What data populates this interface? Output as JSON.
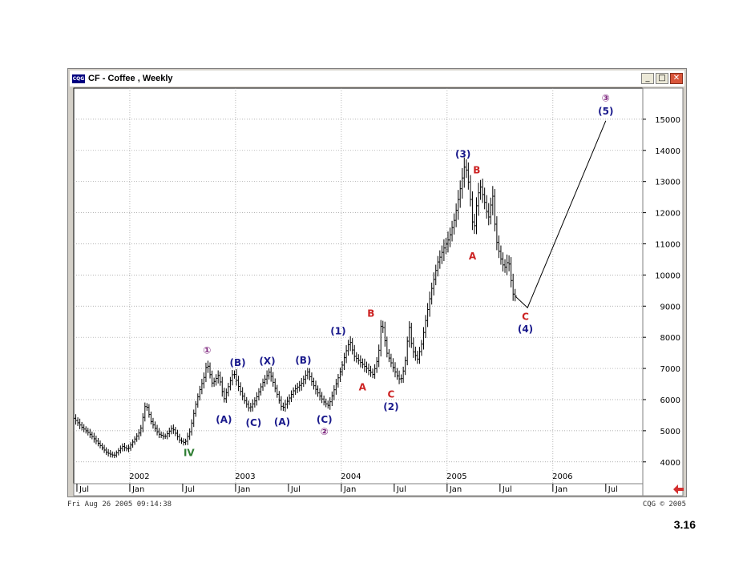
{
  "window": {
    "title": "CF - Coffee , Weekly",
    "icon": "cqg-app-icon",
    "app_icon_text": "CQG",
    "buttons": {
      "minimize": "_",
      "maximize": "□",
      "close": "✕"
    }
  },
  "footer": {
    "timestamp": "Fri Aug 26 2005 09:14:38",
    "copyright": "CQG © 2005"
  },
  "slide_number": "3.16",
  "scroll_arrow_icon": "left-arrow-icon",
  "colors": {
    "price_bars": "#000000",
    "label_blue": "#1a1a8c",
    "label_red": "#cc2222",
    "label_purple": "#7a1f7a",
    "label_green": "#2e7d32",
    "grid": "#9a9a9a",
    "arrow": "#d32f2f"
  },
  "chart_data": {
    "type": "bar",
    "title": "",
    "xlabel": "",
    "ylabel": "",
    "ylim": [
      3300,
      16000
    ],
    "y_ticks": [
      4000,
      5000,
      6000,
      7000,
      8000,
      9000,
      10000,
      11000,
      12000,
      13000,
      14000,
      15000
    ],
    "y_tick_labels": [
      "4000",
      "5000",
      "6000",
      "7000",
      "8000",
      "9000",
      "10000",
      "11000",
      "12000",
      "13000",
      "14000",
      "15000"
    ],
    "x_range": [
      2001.47,
      2006.85
    ],
    "x_year_labels": [
      {
        "label": "2002",
        "x": 2002.0
      },
      {
        "label": "2003",
        "x": 2003.0
      },
      {
        "label": "2004",
        "x": 2004.0
      },
      {
        "label": "2005",
        "x": 2005.0
      },
      {
        "label": "2006",
        "x": 2006.0
      }
    ],
    "x_month_labels": [
      {
        "label": "Jul",
        "x": 2001.5
      },
      {
        "label": "Jan",
        "x": 2002.0
      },
      {
        "label": "Jul",
        "x": 2002.5
      },
      {
        "label": "Jan",
        "x": 2003.0
      },
      {
        "label": "Jul",
        "x": 2003.5
      },
      {
        "label": "Jan",
        "x": 2004.0
      },
      {
        "label": "Jul",
        "x": 2004.5
      },
      {
        "label": "Jan",
        "x": 2005.0
      },
      {
        "label": "Jul",
        "x": 2005.5
      },
      {
        "label": "Jan",
        "x": 2006.0
      },
      {
        "label": "Jul",
        "x": 2006.5
      }
    ],
    "grid": true,
    "price_path": [
      [
        2001.47,
        5400
      ],
      [
        2001.55,
        5100
      ],
      [
        2001.62,
        4900
      ],
      [
        2001.7,
        4600
      ],
      [
        2001.78,
        4300
      ],
      [
        2001.85,
        4200
      ],
      [
        2001.93,
        4500
      ],
      [
        2001.98,
        4400
      ],
      [
        2002.04,
        4700
      ],
      [
        2002.1,
        5000
      ],
      [
        2002.15,
        5900
      ],
      [
        2002.2,
        5300
      ],
      [
        2002.27,
        4900
      ],
      [
        2002.33,
        4800
      ],
      [
        2002.4,
        5100
      ],
      [
        2002.47,
        4700
      ],
      [
        2002.52,
        4600
      ],
      [
        2002.57,
        5000
      ],
      [
        2002.62,
        5800
      ],
      [
        2002.66,
        6300
      ],
      [
        2002.7,
        6700
      ],
      [
        2002.73,
        7200
      ],
      [
        2002.78,
        6500
      ],
      [
        2002.84,
        6800
      ],
      [
        2002.89,
        6000
      ],
      [
        2002.93,
        6400
      ],
      [
        2002.98,
        6900
      ],
      [
        2003.03,
        6400
      ],
      [
        2003.08,
        6000
      ],
      [
        2003.13,
        5700
      ],
      [
        2003.19,
        6000
      ],
      [
        2003.25,
        6500
      ],
      [
        2003.32,
        6900
      ],
      [
        2003.38,
        6300
      ],
      [
        2003.44,
        5700
      ],
      [
        2003.5,
        6000
      ],
      [
        2003.55,
        6300
      ],
      [
        2003.62,
        6500
      ],
      [
        2003.68,
        6900
      ],
      [
        2003.73,
        6500
      ],
      [
        2003.78,
        6200
      ],
      [
        2003.84,
        5900
      ],
      [
        2003.88,
        5800
      ],
      [
        2003.94,
        6400
      ],
      [
        2004.0,
        7000
      ],
      [
        2004.04,
        7500
      ],
      [
        2004.08,
        7900
      ],
      [
        2004.12,
        7400
      ],
      [
        2004.18,
        7200
      ],
      [
        2004.24,
        7000
      ],
      [
        2004.3,
        6800
      ],
      [
        2004.35,
        7400
      ],
      [
        2004.38,
        8600
      ],
      [
        2004.43,
        7500
      ],
      [
        2004.48,
        7100
      ],
      [
        2004.52,
        6800
      ],
      [
        2004.56,
        6600
      ],
      [
        2004.6,
        7100
      ],
      [
        2004.64,
        8400
      ],
      [
        2004.67,
        7600
      ],
      [
        2004.72,
        7300
      ],
      [
        2004.76,
        7800
      ],
      [
        2004.8,
        8600
      ],
      [
        2004.85,
        9500
      ],
      [
        2004.91,
        10400
      ],
      [
        2004.96,
        10800
      ],
      [
        2005.02,
        11200
      ],
      [
        2005.07,
        11800
      ],
      [
        2005.12,
        12700
      ],
      [
        2005.17,
        13600
      ],
      [
        2005.21,
        12800
      ],
      [
        2005.25,
        11300
      ],
      [
        2005.28,
        12300
      ],
      [
        2005.31,
        12900
      ],
      [
        2005.35,
        12400
      ],
      [
        2005.39,
        11800
      ],
      [
        2005.43,
        12600
      ],
      [
        2005.46,
        11200
      ],
      [
        2005.5,
        10600
      ],
      [
        2005.54,
        10200
      ],
      [
        2005.58,
        10500
      ],
      [
        2005.62,
        9400
      ],
      [
        2005.65,
        9300
      ]
    ],
    "projection": [
      [
        2005.65,
        9300
      ],
      [
        2005.76,
        8950
      ],
      [
        2006.5,
        14950
      ]
    ],
    "wave_labels": [
      {
        "text": "IV",
        "x": 2002.56,
        "y": 4280,
        "color": "green"
      },
      {
        "text": "①",
        "x": 2002.73,
        "y": 7570,
        "color": "purple"
      },
      {
        "text": "(A)",
        "x": 2002.89,
        "y": 5340,
        "color": "blue"
      },
      {
        "text": "(B)",
        "x": 2003.02,
        "y": 7170,
        "color": "blue"
      },
      {
        "text": "(C)",
        "x": 2003.17,
        "y": 5240,
        "color": "blue"
      },
      {
        "text": "(X)",
        "x": 2003.3,
        "y": 7220,
        "color": "blue"
      },
      {
        "text": "(A)",
        "x": 2003.44,
        "y": 5270,
        "color": "blue"
      },
      {
        "text": "(B)",
        "x": 2003.64,
        "y": 7240,
        "color": "blue"
      },
      {
        "text": "(C)",
        "x": 2003.84,
        "y": 5340,
        "color": "blue"
      },
      {
        "text": "②",
        "x": 2003.84,
        "y": 4960,
        "color": "purple"
      },
      {
        "text": "(1)",
        "x": 2003.97,
        "y": 8180,
        "color": "blue"
      },
      {
        "text": "A",
        "x": 2004.2,
        "y": 6380,
        "color": "red"
      },
      {
        "text": "B",
        "x": 2004.28,
        "y": 8750,
        "color": "red"
      },
      {
        "text": "C",
        "x": 2004.47,
        "y": 6150,
        "color": "red"
      },
      {
        "text": "(2)",
        "x": 2004.47,
        "y": 5750,
        "color": "blue"
      },
      {
        "text": "(3)",
        "x": 2005.15,
        "y": 13860,
        "color": "blue"
      },
      {
        "text": "B",
        "x": 2005.28,
        "y": 13350,
        "color": "red"
      },
      {
        "text": "A",
        "x": 2005.24,
        "y": 10590,
        "color": "red"
      },
      {
        "text": "C",
        "x": 2005.74,
        "y": 8650,
        "color": "red"
      },
      {
        "text": "(4)",
        "x": 2005.74,
        "y": 8250,
        "color": "blue"
      },
      {
        "text": "③",
        "x": 2006.5,
        "y": 15660,
        "color": "purple"
      },
      {
        "text": "(5)",
        "x": 2006.5,
        "y": 15240,
        "color": "blue"
      }
    ]
  }
}
